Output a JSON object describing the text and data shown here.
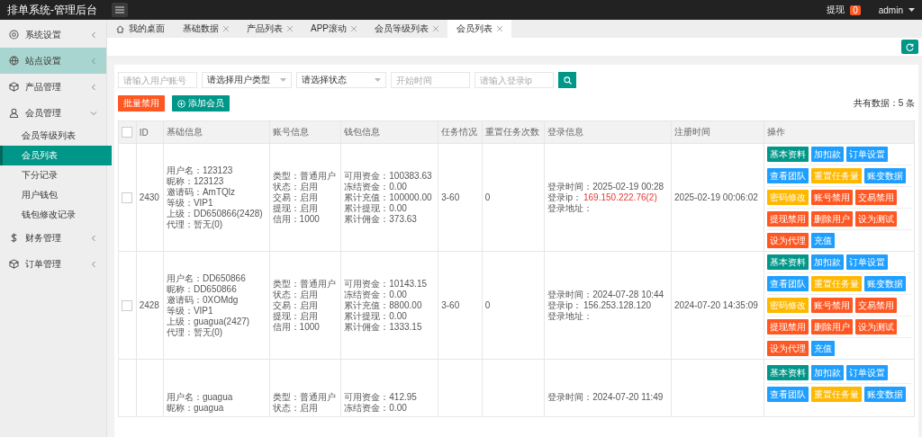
{
  "header": {
    "title": "排单系统-管理后台",
    "withdraw_label": "提现",
    "withdraw_count": "0",
    "user": "admin"
  },
  "sidebar": {
    "items": [
      {
        "label": "系统设置",
        "expanded": false,
        "highlighted": false
      },
      {
        "label": "站点设置",
        "expanded": false,
        "highlighted": true
      },
      {
        "label": "产品管理",
        "expanded": false,
        "highlighted": false
      },
      {
        "label": "会员管理",
        "expanded": true,
        "highlighted": false,
        "children": [
          {
            "label": "会员等级列表",
            "selected": false
          },
          {
            "label": "会员列表",
            "selected": true
          },
          {
            "label": "下分记录",
            "selected": false
          },
          {
            "label": "用户钱包",
            "selected": false
          },
          {
            "label": "钱包修改记录",
            "selected": false
          }
        ]
      },
      {
        "label": "财务管理",
        "expanded": false,
        "highlighted": false
      },
      {
        "label": "订单管理",
        "expanded": false,
        "highlighted": false
      }
    ]
  },
  "tabs": [
    {
      "label": "我的桌面",
      "kind": "home",
      "selected": false
    },
    {
      "label": "基础数据",
      "kind": "closable",
      "selected": false
    },
    {
      "label": "产品列表",
      "kind": "closable",
      "selected": false
    },
    {
      "label": "APP滚动",
      "kind": "closable",
      "selected": false
    },
    {
      "label": "会员等级列表",
      "kind": "closable",
      "selected": false
    },
    {
      "label": "会员列表",
      "kind": "closable",
      "selected": true
    }
  ],
  "filters": [
    {
      "kind": "input",
      "placeholder": "请输入用户账号"
    },
    {
      "kind": "select",
      "placeholder": "请选择用户类型"
    },
    {
      "kind": "select",
      "placeholder": "请选择状态"
    },
    {
      "kind": "input",
      "placeholder": "开始时间"
    },
    {
      "kind": "input",
      "placeholder": "请输入登录ip"
    }
  ],
  "toolbar": {
    "batch_disable": "批量禁用",
    "add_member": "添加会员",
    "total": "共有数据：5 条"
  },
  "table": {
    "select_all_checked": false,
    "columns": [
      "ID",
      "基础信息",
      "账号信息",
      "钱包信息",
      "任务情况",
      "重置任务次数",
      "登录信息",
      "注册时间",
      "操作"
    ],
    "rows": [
      {
        "checked": false,
        "id": "2430",
        "basic": [
          "用户名：123123",
          "昵称：123123",
          "邀请码：AmTQlz",
          "等级：VIP1",
          "上级：DD650866(2428)",
          "代理：暂无(0)"
        ],
        "account": [
          "类型：普通用户",
          "状态：启用",
          "交易：启用",
          "提现：启用",
          "信用：1000"
        ],
        "wallet": [
          "可用资金：100383.63",
          "冻结资金：0.00",
          "累计充值：100000.00",
          "累计提现：0.00",
          "累计佣金：373.63"
        ],
        "task": "3-60",
        "reset_count": "0",
        "login": {
          "time": "登录时间：2025-02-19 00:28",
          "ip_label": "登录ip：",
          "ip": "169.150.222.76(2)",
          "ip_flagged": true,
          "address": "登录地址："
        },
        "registered": "2025-02-19 00:06:02",
        "actions": [
          [
            {
              "label": "基本资料",
              "kind": "primary"
            },
            {
              "label": "加扣款",
              "kind": "normal"
            },
            {
              "label": "订单设置",
              "kind": "normal"
            }
          ],
          [
            {
              "label": "查看团队",
              "kind": "normal"
            },
            {
              "label": "重置任务量",
              "kind": "warm"
            },
            {
              "label": "账变数据",
              "kind": "normal"
            }
          ],
          [
            {
              "label": "密码修改",
              "kind": "warm"
            },
            {
              "label": "账号禁用",
              "kind": "danger"
            },
            {
              "label": "交易禁用",
              "kind": "danger"
            }
          ],
          [
            {
              "label": "提现禁用",
              "kind": "danger"
            },
            {
              "label": "删除用户",
              "kind": "danger"
            },
            {
              "label": "设为测试",
              "kind": "danger"
            }
          ],
          [
            {
              "label": "设为代理",
              "kind": "danger"
            },
            {
              "label": "充值",
              "kind": "normal"
            }
          ]
        ]
      },
      {
        "checked": false,
        "id": "2428",
        "basic": [
          "用户名：DD650866",
          "昵称：DD650866",
          "邀请码：0XOMdg",
          "等级：VIP1",
          "上级：guagua(2427)",
          "代理：暂无(0)"
        ],
        "account": [
          "类型：普通用户",
          "状态：启用",
          "交易：启用",
          "提现：启用",
          "信用：1000"
        ],
        "wallet": [
          "可用资金：10143.15",
          "冻结资金：0.00",
          "累计充值：8800.00",
          "累计提现：0.00",
          "累计佣金：1333.15"
        ],
        "task": "3-60",
        "reset_count": "0",
        "login": {
          "time": "登录时间：2024-07-28 10:44",
          "ip_label": "登录ip：",
          "ip": "156.253.128.120",
          "ip_flagged": false,
          "address": "登录地址："
        },
        "registered": "2024-07-20 14:35:09",
        "actions": [
          [
            {
              "label": "基本资料",
              "kind": "primary"
            },
            {
              "label": "加扣款",
              "kind": "normal"
            },
            {
              "label": "订单设置",
              "kind": "normal"
            }
          ],
          [
            {
              "label": "查看团队",
              "kind": "normal"
            },
            {
              "label": "重置任务量",
              "kind": "warm"
            },
            {
              "label": "账变数据",
              "kind": "normal"
            }
          ],
          [
            {
              "label": "密码修改",
              "kind": "warm"
            },
            {
              "label": "账号禁用",
              "kind": "danger"
            },
            {
              "label": "交易禁用",
              "kind": "danger"
            }
          ],
          [
            {
              "label": "提现禁用",
              "kind": "danger"
            },
            {
              "label": "删除用户",
              "kind": "danger"
            },
            {
              "label": "设为测试",
              "kind": "danger"
            }
          ],
          [
            {
              "label": "设为代理",
              "kind": "danger"
            },
            {
              "label": "充值",
              "kind": "normal"
            }
          ]
        ]
      },
      {
        "basic": [
          "用户名：guagua",
          "昵称：guagua"
        ],
        "account": [
          "类型：普通用户",
          "状态：启用"
        ],
        "wallet": [
          "可用资金：412.95",
          "冻结资金：0.00"
        ],
        "login": {
          "time": "登录时间：2024-07-20 11:49"
        },
        "actions": [
          [
            {
              "label": "基本资料",
              "kind": "primary"
            },
            {
              "label": "加扣款",
              "kind": "normal"
            },
            {
              "label": "订单设置",
              "kind": "normal"
            }
          ],
          [
            {
              "label": "查看团队",
              "kind": "normal"
            },
            {
              "label": "重置任务量",
              "kind": "warm"
            },
            {
              "label": "账变数据",
              "kind": "normal"
            }
          ]
        ]
      }
    ]
  }
}
